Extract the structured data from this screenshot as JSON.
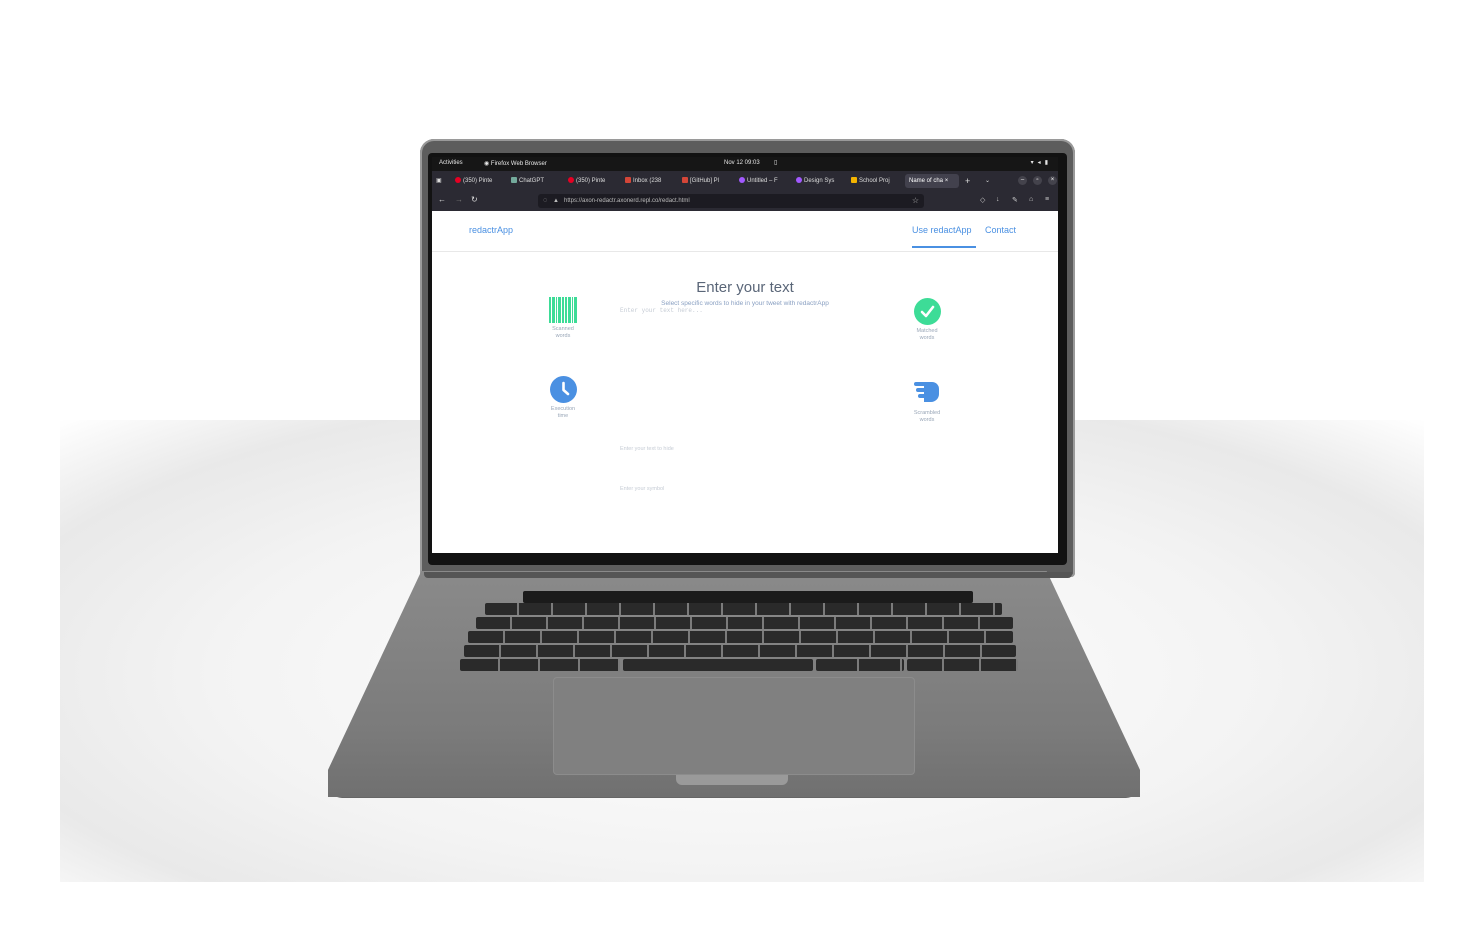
{
  "system": {
    "activities": "Activities",
    "app_name": "Firefox Web Browser",
    "clock": "Nov 12  09:03"
  },
  "browser": {
    "tabs": [
      {
        "label": "(350) Pinte",
        "icon": "pinterest-icon",
        "color": "#e60023"
      },
      {
        "label": "ChatGPT",
        "icon": "chatgpt-icon",
        "color": "#74aa9c"
      },
      {
        "label": "(350) Pinte",
        "icon": "pinterest-icon",
        "color": "#e60023"
      },
      {
        "label": "Inbox (238",
        "icon": "gmail-icon",
        "color": "#d44638"
      },
      {
        "label": "[GitHub] Pl",
        "icon": "gmail-icon",
        "color": "#d44638"
      },
      {
        "label": "Untitled – F",
        "icon": "figma-icon",
        "color": "#a259ff"
      },
      {
        "label": "Design Sys",
        "icon": "figma-icon",
        "color": "#a259ff"
      },
      {
        "label": "School Proj",
        "icon": "doc-icon",
        "color": "#f4b400"
      },
      {
        "label": "Name of cha",
        "icon": "none",
        "color": "#42414d"
      }
    ],
    "url": "https://axon-redactr.axonerd.repl.co/redact.html"
  },
  "page": {
    "logo": "redactrApp",
    "nav": {
      "use": "Use redactApp",
      "contact": "Contact"
    },
    "title": "Enter your text",
    "subtitle": "Select specific words to hide in your tweet with redactrApp",
    "textarea_placeholder": "Enter your text here...",
    "hide_placeholder": "Enter your text to hide",
    "symbol_placeholder": "Enter your symbol",
    "stats": {
      "scanned": "Scanned words",
      "matched": "Matched words",
      "execution": "Execution time",
      "scrambled": "Scrambled words"
    },
    "accent": "#4a90e2",
    "green": "#3ddc97"
  }
}
